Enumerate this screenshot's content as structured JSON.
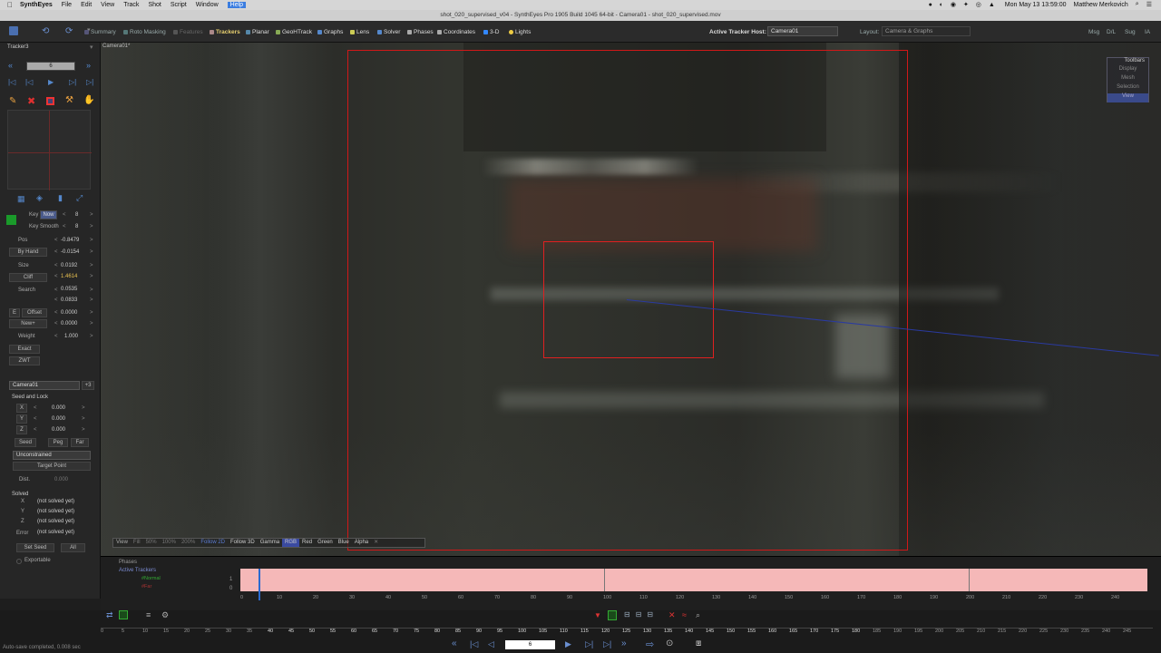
{
  "menubar": {
    "app": "SynthEyes",
    "items": [
      "File",
      "Edit",
      "View",
      "Track",
      "Shot",
      "Script",
      "Window",
      "Help"
    ],
    "clock": "Mon May 13  13:59:00",
    "user": "Matthew Merkovich"
  },
  "window": {
    "title": "shot_020_supervised_v04 - SynthEyes Pro 1905 Build 1045 64-bit - Camera01 - shot_020_supervised.mov"
  },
  "toolbar": {
    "tabs": [
      "Summary",
      "Roto Masking",
      "Features",
      "Trackers",
      "Planar",
      "GeoHTrack",
      "Graphs",
      "Lens",
      "Solver",
      "Phases",
      "Coordinates",
      "3-D",
      "Lights"
    ],
    "active_tab": "Trackers",
    "host_label": "Active Tracker Host:",
    "host_value": "Camera01",
    "layout_label": "Layout:",
    "layout_value": "Camera & Graphs",
    "right_buttons": [
      "Msg",
      "D/L",
      "Sug",
      "IA"
    ]
  },
  "panel": {
    "tracker_name": "Tracker3",
    "frame": "6",
    "key_label": "Key",
    "key_now": "Now",
    "key_val": "8",
    "key_smooth_label": "Key Smooth",
    "key_smooth_val": "8",
    "pos_label": "Pos",
    "pos_x": "-0.8479",
    "pos_y": "-0.0154",
    "byhand": "By Hand",
    "size_label": "Size",
    "size_x": "0.0192",
    "cliff": "Cliff",
    "size_y": "1.4614",
    "search_label": "Search",
    "search_x": "0.0535",
    "search_y": "0.0833",
    "offset_e": "E",
    "offset_label": "Offset",
    "offset_val": "0.0000",
    "new_label": "New+",
    "new_val": "0.0000",
    "weight_label": "Weight",
    "weight_val": "1.000",
    "exact": "Exact",
    "zwt": "ZWT",
    "camera": "Camera01",
    "camera_num": "+3",
    "seed_lock": "Seed and Lock",
    "x": "X",
    "y": "Y",
    "z": "Z",
    "x_val": "0.000",
    "y_val": "0.000",
    "z_val": "0.000",
    "seed": "Seed",
    "peg": "Peg",
    "far": "Far",
    "constraint": "Unconstrained",
    "target_point": "Target Point",
    "dist_label": "Dist.",
    "dist_val": "0.000",
    "solved": "Solved",
    "not_solved": "(not solved yet)",
    "error_label": "Error",
    "set_seed": "Set Seed",
    "all": "All",
    "exportable": "Exportable"
  },
  "viewport": {
    "camera_label": "Camera01*",
    "title_toolbars": "Toolbars",
    "menu": [
      "Display",
      "Mesh",
      "Selection",
      "View"
    ],
    "bottom_buttons": [
      "View",
      "Fill",
      "50%",
      "100%",
      "200%",
      "Follow 2D",
      "Follow 3D",
      "Gamma",
      "RGB",
      "Red",
      "Green",
      "Blue",
      "Alpha"
    ],
    "active_bottom": "RGB"
  },
  "timeline": {
    "phases": "Phases",
    "active_trackers": "Active Trackers",
    "normal": "#Normal",
    "far": "#Far",
    "val1": "1",
    "val0": "0",
    "ticks": [
      "0",
      "10",
      "20",
      "30",
      "40",
      "50",
      "60",
      "70",
      "80",
      "90",
      "100",
      "110",
      "120",
      "130",
      "140",
      "150",
      "160",
      "170",
      "180",
      "190",
      "200",
      "210",
      "220",
      "230",
      "240"
    ]
  },
  "bottom": {
    "ticks": [
      "0",
      "5",
      "10",
      "15",
      "20",
      "25",
      "30",
      "35",
      "40",
      "45",
      "50",
      "55",
      "60",
      "65",
      "70",
      "75",
      "80",
      "85",
      "90",
      "95",
      "100",
      "105",
      "110",
      "115",
      "120",
      "125",
      "130",
      "135",
      "140",
      "145",
      "150",
      "155",
      "160",
      "165",
      "170",
      "175",
      "180",
      "185",
      "190",
      "195",
      "200",
      "205",
      "210",
      "215",
      "220",
      "225",
      "230",
      "235",
      "240",
      "245"
    ],
    "frame_field": "6",
    "status": "Auto-save completed, 0.008 sec"
  },
  "colors": {
    "accent": "#e8d070",
    "tracker_red": "#e02020",
    "timeline_pink": "#f5b8b8"
  }
}
